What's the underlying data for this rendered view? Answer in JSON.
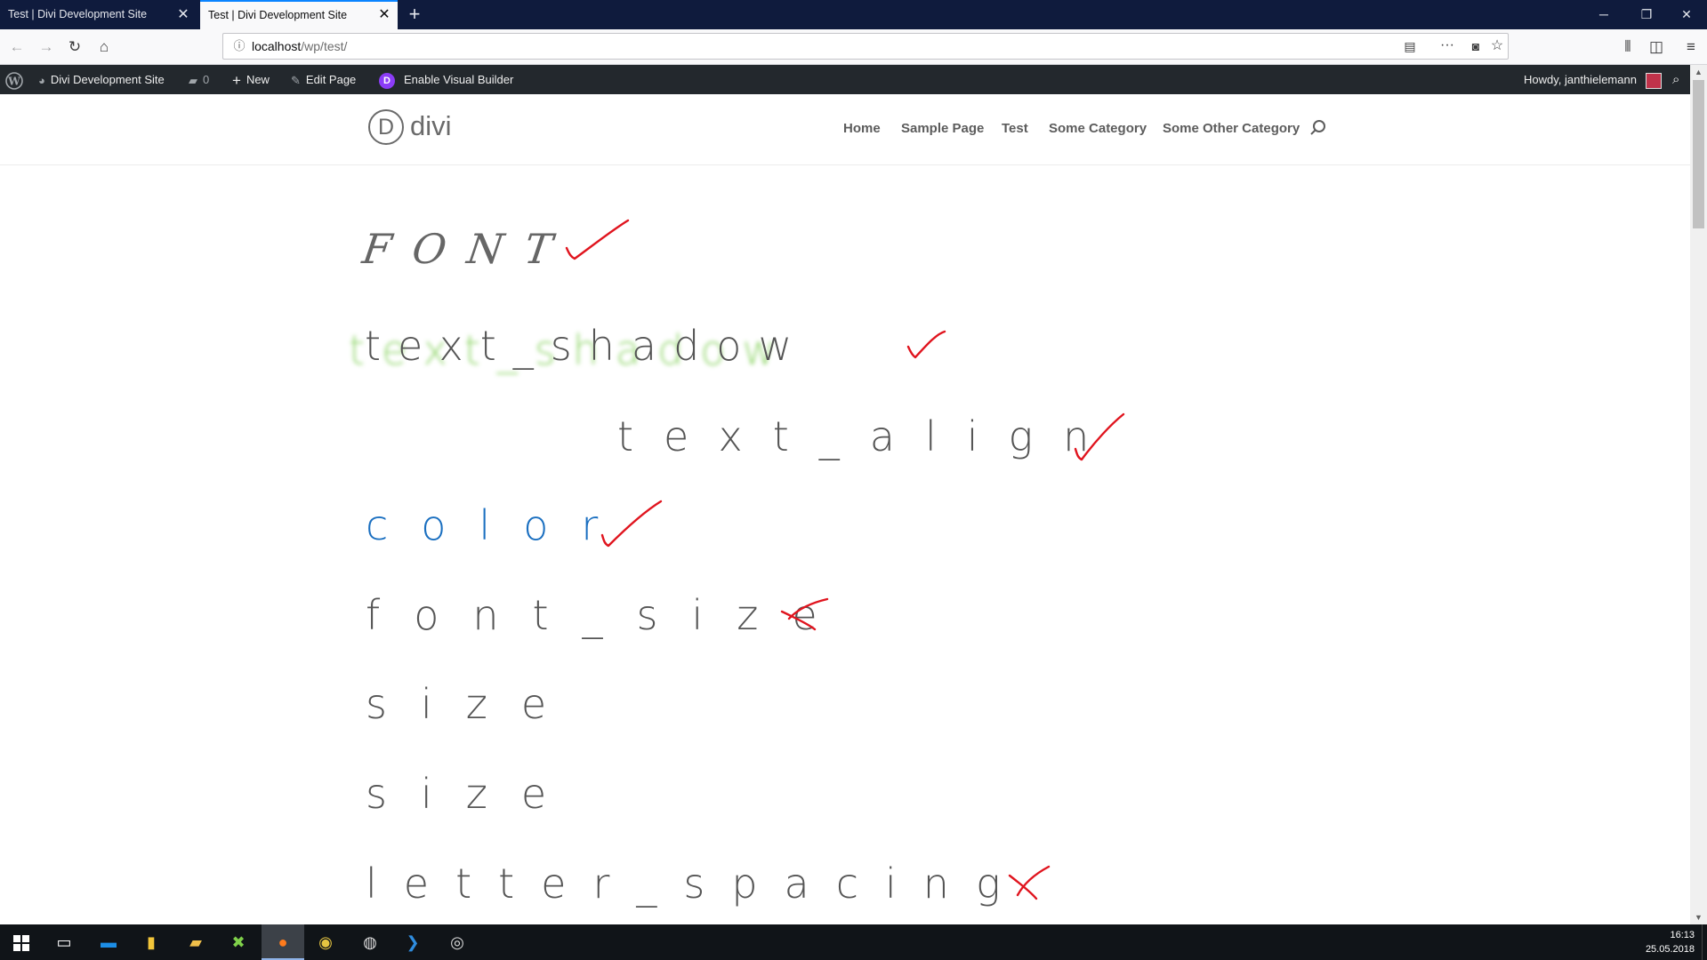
{
  "browser": {
    "tabs": [
      {
        "title": "Test | Divi Development Site",
        "active": false
      },
      {
        "title": "Test | Divi Development Site",
        "active": true
      }
    ],
    "new_tab_icon": "plus-icon",
    "url_host": "localhost",
    "url_path": "/wp/test/",
    "window_controls": [
      "minimize-icon",
      "restore-icon",
      "close-icon"
    ]
  },
  "admin_bar": {
    "site_name": "Divi Development Site",
    "comments_count": "0",
    "new_label": "New",
    "edit_label": "Edit Page",
    "visual_builder_label": "Enable Visual Builder",
    "divi_badge": "D",
    "howdy": "Howdy, janthielemann"
  },
  "site": {
    "logo_letter": "D",
    "logo_text": "divi",
    "menu": [
      "Home",
      "Sample Page",
      "Test",
      "Some Category",
      "Some Other Category"
    ]
  },
  "content": {
    "line_font": "FONT",
    "line_text_shadow": "text_shadow",
    "line_text_align": "text_align",
    "line_color": "color",
    "line_font_size": "font_size",
    "line_size_1": "size",
    "line_size_2": "size",
    "line_letter_spacing": "letter_spacing"
  },
  "annotations": {
    "color": "#e0141e",
    "marks": [
      "check",
      "check",
      "check",
      "check",
      "cross",
      "cross"
    ]
  },
  "colors": {
    "tabbar": "#0f1b3d",
    "adminbar": "#23282d",
    "text": "#555555",
    "blue_text": "#1a6fc0",
    "shadow_green": "#6ec83c",
    "accent": "#0a84ff"
  },
  "taskbar": {
    "time": "16:13",
    "date": "25.05.2018"
  }
}
